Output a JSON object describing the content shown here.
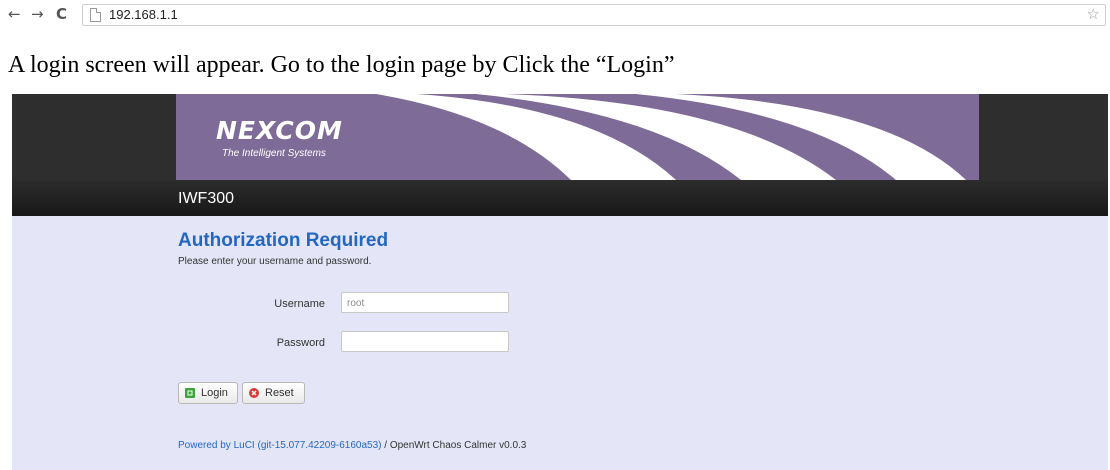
{
  "browser": {
    "back_icon": "←",
    "forward_icon": "→",
    "reload_icon": "C",
    "url": "192.168.1.1",
    "bookmark_icon": "☆"
  },
  "instruction": "A login screen will appear. Go to the login page by Click the “Login”",
  "router": {
    "logo": {
      "brand": "NEXCOM",
      "tagline": "The Intelligent Systems"
    },
    "model": "IWF300",
    "auth": {
      "title": "Authorization Required",
      "subtitle": "Please enter your username and password."
    },
    "form": {
      "username_label": "Username",
      "username_value": "root",
      "password_label": "Password",
      "password_value": ""
    },
    "buttons": {
      "login": "Login",
      "reset": "Reset"
    },
    "footer": {
      "link": "Powered by LuCI (git-15.077.42209-6160a53)",
      "text": " / OpenWrt Chaos Calmer v0.0.3"
    }
  },
  "colors": {
    "banner_purple": "#7e6b97",
    "title_blue": "#2367c2",
    "page_bg": "#e4e6f7",
    "header_dark": "#2e2e2e"
  }
}
